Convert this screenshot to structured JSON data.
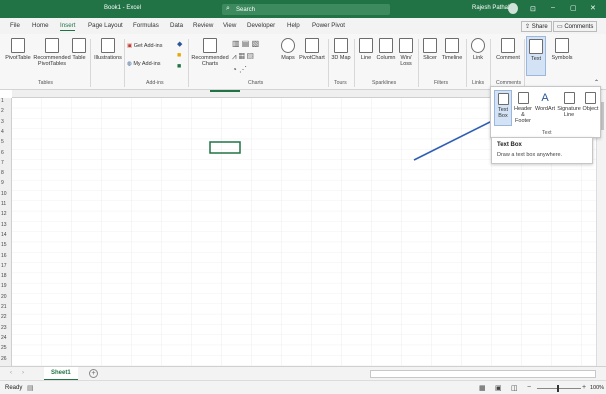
{
  "titlebar": {
    "doc_title": "Book1 - Excel",
    "search_placeholder": "Search",
    "user_name": "Rajesh Pathak",
    "minimize": "–",
    "restore": "▢",
    "close": "✕"
  },
  "tabs": [
    "File",
    "Home",
    "Insert",
    "Page Layout",
    "Formulas",
    "Data",
    "Review",
    "View",
    "Developer",
    "Help",
    "Power Pivot"
  ],
  "active_tab": "Insert",
  "share_label": "Share",
  "comments_label": "Comments",
  "ribbon": {
    "pivottable": "PivotTable",
    "recommended_pivottables": "Recommended PivotTables",
    "table": "Table",
    "illustrations": "Illustrations",
    "get_addins": "Get Add-ins",
    "my_addins": "My Add-ins",
    "recommended_charts": "Recommended Charts",
    "maps": "Maps",
    "pivotchart": "PivotChart",
    "map3d": "3D Map",
    "line": "Line",
    "column": "Column",
    "winloss": "Win/ Loss",
    "slicer": "Slicer",
    "timeline": "Timeline",
    "link": "Link",
    "comment": "Comment",
    "text": "Text",
    "symbols": "Symbols",
    "groups": {
      "tables": "Tables",
      "addins": "Add-ins",
      "charts": "Charts",
      "tours": "Tours",
      "sparklines": "Sparklines",
      "filters": "Filters",
      "links": "Links",
      "comments": "Comments"
    }
  },
  "text_menu": {
    "textbox": "Text Box",
    "header_footer": "Header & Footer",
    "wordart": "WordArt",
    "signature_line": "Signature Line",
    "object": "Object",
    "group_label": "Text"
  },
  "tooltip": {
    "title": "Text Box",
    "description": "Draw a text box anywhere."
  },
  "rows": [
    "1",
    "2",
    "3",
    "4",
    "5",
    "6",
    "7",
    "8",
    "9",
    "10",
    "11",
    "12",
    "13",
    "14",
    "15",
    "16",
    "17",
    "18",
    "19",
    "20",
    "21",
    "22",
    "23",
    "24",
    "25",
    "26"
  ],
  "sheet_tab": "Sheet1",
  "status": {
    "ready": "Ready",
    "zoom": "100%"
  },
  "colors": {
    "excel_green": "#217346",
    "arrow_blue": "#2f5fb3"
  }
}
